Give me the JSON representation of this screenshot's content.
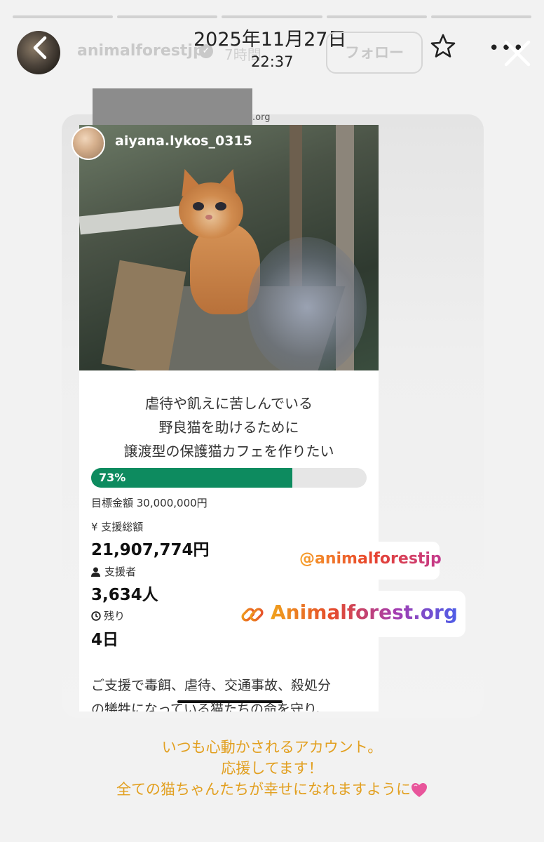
{
  "story": {
    "segments": [
      1,
      2,
      3,
      4,
      5
    ],
    "date": "2025年11月27日",
    "time": "22:37"
  },
  "header": {
    "username": "animalforestjp",
    "time_ago": "7時間",
    "follow_label": "フォロー",
    "more": "•••"
  },
  "embedded_post": {
    "domain_fragment": ".org",
    "account_name": "aiyana.lykos_0315",
    "headline_lines": [
      "虐待や飢えに苦しんでいる",
      "野良猫を助けるために",
      "譲渡型の保護猫カフェを作りたい"
    ],
    "progress": {
      "percent_label": "73%",
      "value": 0.73
    },
    "goal": "目標金額 30,000,000円",
    "total_label": "¥  支援総額",
    "total_value": "21,907,774円",
    "supporters_label": "支援者",
    "supporters_value": "3,634人",
    "remaining_label": "残り",
    "remaining_value": "4日",
    "body_lines": [
      "ご支援で毒餌、虐待、交通事故、殺処分",
      "の犠牲になっている猫たちの命を守り、"
    ]
  },
  "stickers": {
    "mention": "@animalforestjp",
    "link": "Animalforest.org"
  },
  "caption_lines": [
    "いつも心動かされるアカウント。",
    "応援してます！",
    "全ての猫ちゃんたちが幸せになれますように"
  ],
  "colors": {
    "progress_fill": "#0d8b5f",
    "caption": "#e2a021"
  }
}
